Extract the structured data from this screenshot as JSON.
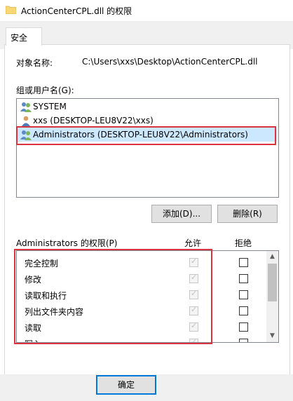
{
  "window": {
    "title": "ActionCenterCPL.dll 的权限"
  },
  "tab": {
    "label": "安全"
  },
  "object": {
    "label": "对象名称:",
    "path": "C:\\Users\\xxs\\Desktop\\ActionCenterCPL.dll"
  },
  "groups": {
    "label": "组或用户名(G):",
    "items": [
      {
        "name": "SYSTEM",
        "icon": "users-group-icon",
        "selected": false
      },
      {
        "name": "xxs (DESKTOP-LEU8V22\\xxs)",
        "icon": "user-icon",
        "selected": false
      },
      {
        "name": "Administrators (DESKTOP-LEU8V22\\Administrators)",
        "icon": "users-group-icon",
        "selected": true
      }
    ],
    "add_label": "添加(D)...",
    "remove_label": "删除(R)"
  },
  "permissions": {
    "title": "Administrators 的权限(P)",
    "allow_header": "允许",
    "deny_header": "拒绝",
    "rows": [
      {
        "name": "完全控制",
        "allow": true,
        "deny": false
      },
      {
        "name": "修改",
        "allow": true,
        "deny": false
      },
      {
        "name": "读取和执行",
        "allow": true,
        "deny": false
      },
      {
        "name": "列出文件夹内容",
        "allow": true,
        "deny": false
      },
      {
        "name": "读取",
        "allow": true,
        "deny": false
      },
      {
        "name": "写入",
        "allow": true,
        "deny": false
      }
    ]
  },
  "footer": {
    "ok_label": "确定"
  },
  "colors": {
    "highlight": "#d9343f",
    "selection": "#cce8ff"
  }
}
